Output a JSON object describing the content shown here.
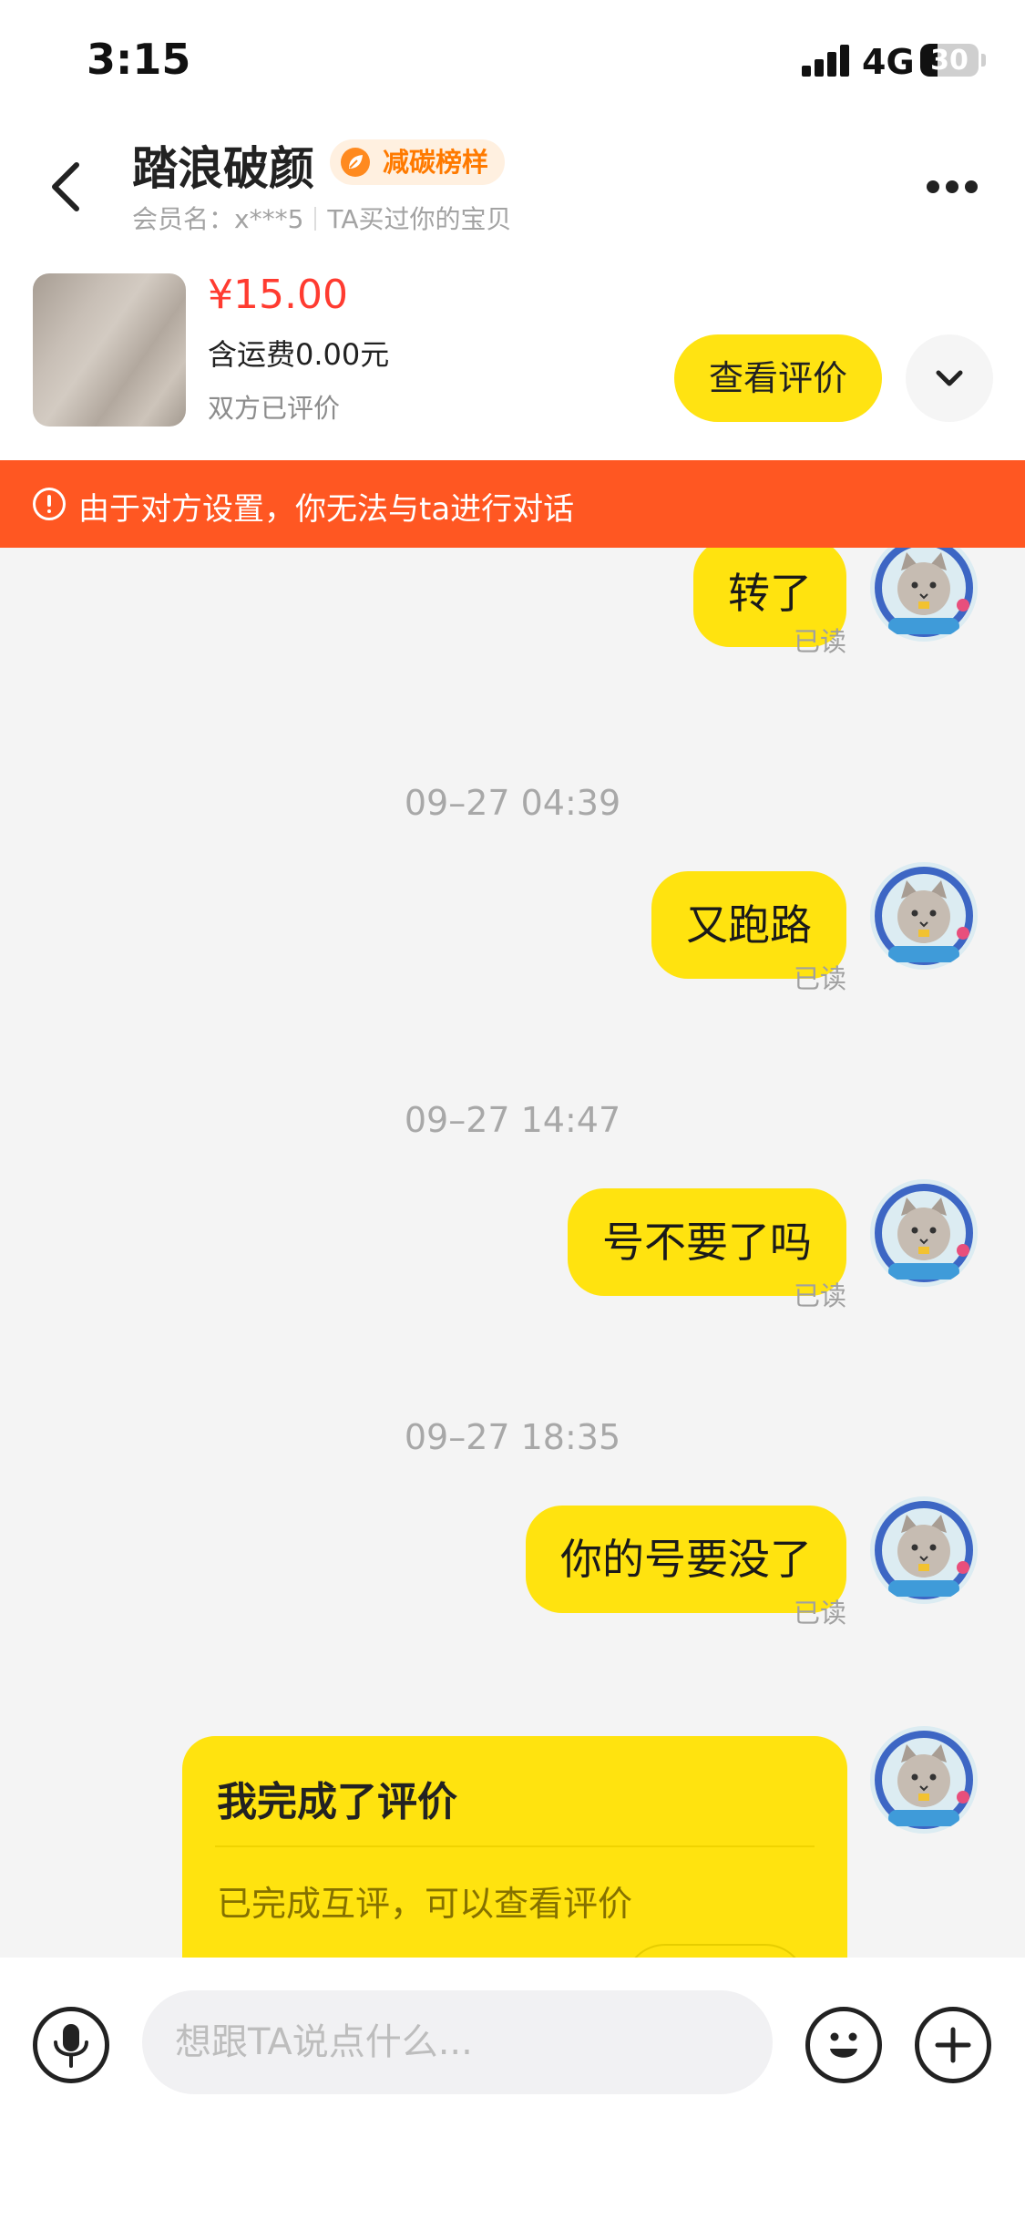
{
  "status_bar": {
    "time": "3:15",
    "network": "4G",
    "battery": "30",
    "battery_level_percent": 30
  },
  "header": {
    "contact_name": "踏浪破颜",
    "badge_label": "减碳榜样",
    "member_label": "会员名：x***5",
    "purchase_note": "TA买过你的宝贝"
  },
  "product": {
    "price": "¥15.00",
    "shipping": "含运费0.00元",
    "review_status": "双方已评价",
    "view_review_label": "查看评价"
  },
  "alert": {
    "text": "由于对方设置，你无法与ta进行对话"
  },
  "messages": [
    {
      "text": "转了",
      "read": "已读"
    },
    {
      "timestamp": "09–27 04:39",
      "text": "又跑路",
      "read": "已读"
    },
    {
      "timestamp": "09–27 14:47",
      "text": "号不要了吗",
      "read": "已读"
    },
    {
      "timestamp": "09–27 18:35",
      "text": "你的号要没了",
      "read": "已读"
    }
  ],
  "review_card": {
    "title": "我完成了评价",
    "subtitle": "已完成互评，可以查看评价"
  },
  "input": {
    "placeholder": "想跟TA说点什么..."
  },
  "colors": {
    "bubble": "#ffe30f",
    "alert": "#ff5722",
    "price": "#ff3b30",
    "badge": "#ff7a00"
  },
  "icons": [
    "back-arrow-icon",
    "leaf-icon",
    "more-dots-icon",
    "chevron-down-icon",
    "alert-circle-icon",
    "microphone-icon",
    "emoji-icon",
    "plus-icon",
    "cat-avatar-icon"
  ]
}
